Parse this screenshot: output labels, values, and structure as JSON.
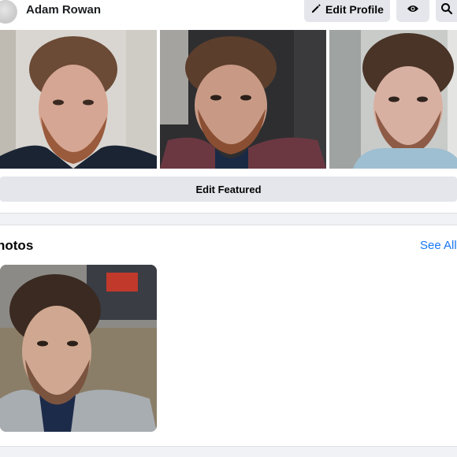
{
  "header": {
    "user_name": "Adam Rowan",
    "edit_profile_label": "Edit Profile",
    "edit_icon": "pencil-icon",
    "view_icon": "eye-icon",
    "search_icon": "search-icon"
  },
  "featured": {
    "edit_label": "Edit Featured"
  },
  "photos": {
    "title": "hotos",
    "see_all_label": "See All"
  },
  "colors": {
    "link": "#1877f2",
    "button_bg": "#e4e6eb",
    "divider_bg": "#f0f2f5"
  }
}
